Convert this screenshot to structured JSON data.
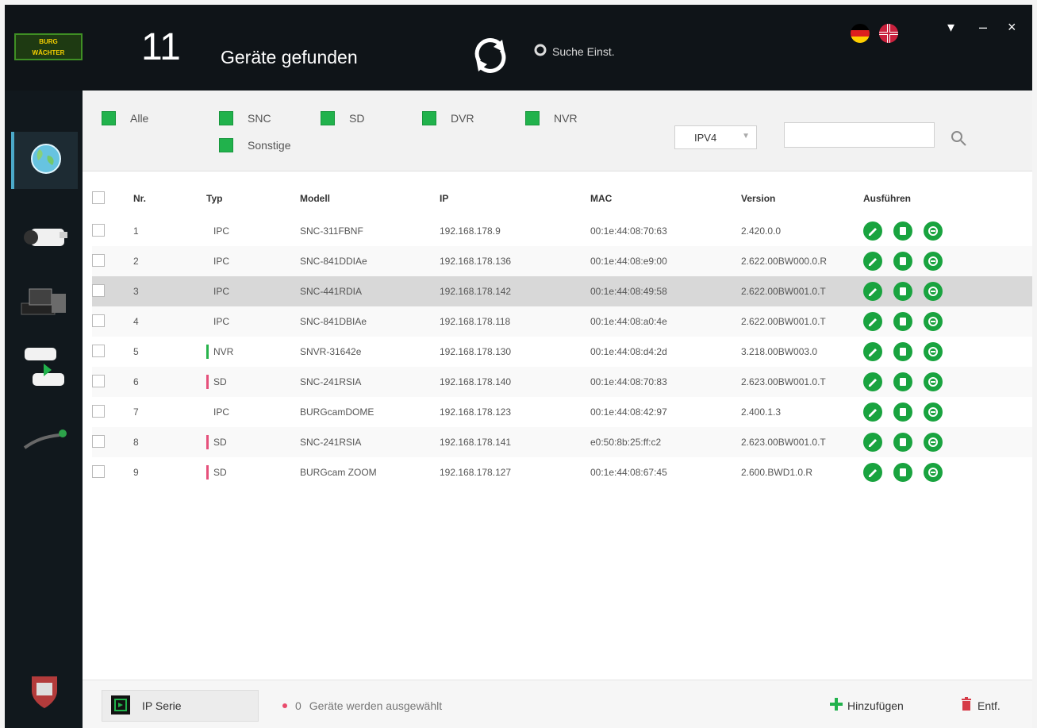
{
  "header": {
    "logo_text": [
      "BURG",
      "WÄCHTER"
    ],
    "count": "11",
    "found_label": "Geräte gefunden",
    "search_settings": "Suche Einst.",
    "window_controls": [
      "▾",
      "–",
      "×"
    ]
  },
  "filters": {
    "items": [
      "Alle",
      "SNC",
      "SD",
      "DVR",
      "NVR",
      "Sonstige"
    ],
    "select_value": "IPV4",
    "search_value": ""
  },
  "table": {
    "columns": [
      "Nr.",
      "Typ",
      "Modell",
      "IP",
      "MAC",
      "Version",
      "Ausführen"
    ],
    "rows": [
      {
        "nr": "1",
        "typ": "IPC",
        "model": "SNC-311FBNF",
        "ip": "192.168.178.9",
        "mac": "00:1e:44:08:70:63",
        "version": "2.420.0.0"
      },
      {
        "nr": "2",
        "typ": "IPC",
        "model": "SNC-841DDIAe",
        "ip": "192.168.178.136",
        "mac": "00:1e:44:08:e9:00",
        "version": "2.622.00BW000.0.R"
      },
      {
        "nr": "3",
        "typ": "IPC",
        "model": "SNC-441RDIA",
        "ip": "192.168.178.142",
        "mac": "00:1e:44:08:49:58",
        "version": "2.622.00BW001.0.T"
      },
      {
        "nr": "4",
        "typ": "IPC",
        "model": "SNC-841DBIAe",
        "ip": "192.168.178.118",
        "mac": "00:1e:44:08:a0:4e",
        "version": "2.622.00BW001.0.T"
      },
      {
        "nr": "5",
        "typ": "NVR",
        "model": "SNVR-31642e",
        "ip": "192.168.178.130",
        "mac": "00:1e:44:08:d4:2d",
        "version": "3.218.00BW003.0"
      },
      {
        "nr": "6",
        "typ": "SD",
        "model": "SNC-241RSIA",
        "ip": "192.168.178.140",
        "mac": "00:1e:44:08:70:83",
        "version": "2.623.00BW001.0.T"
      },
      {
        "nr": "7",
        "typ": "IPC",
        "model": "BURGcamDOME",
        "ip": "192.168.178.123",
        "mac": "00:1e:44:08:42:97",
        "version": "2.400.1.3"
      },
      {
        "nr": "8",
        "typ": "SD",
        "model": "SNC-241RSIA",
        "ip": "192.168.178.141",
        "mac": "e0:50:8b:25:ff:c2",
        "version": "2.623.00BW001.0.T"
      },
      {
        "nr": "9",
        "typ": "SD",
        "model": "BURGcam ZOOM",
        "ip": "192.168.178.127",
        "mac": "00:1e:44:08:67:45",
        "version": "2.600.BWD1.0.R"
      }
    ],
    "selected_row": "3"
  },
  "footer": {
    "ip_serial_label": "IP Serie",
    "selected_count": "0",
    "selected_text": "Geräte werden ausgewählt",
    "add_label": "Hinzufügen",
    "delete_label": "Entf."
  },
  "colors": {
    "accent": "#21b24c",
    "titlebar": "#0f1418",
    "sidebar": "#11181d",
    "type_nvr": "#28b34c",
    "type_sd": "#e6507b"
  },
  "icons": {
    "refresh": "refresh-icon",
    "gear": "gear-icon",
    "globe": "globe-icon",
    "camera": "camera-icon",
    "dvr": "dvr-icon",
    "network_camera": "network-camera-icon",
    "tool": "tool-icon",
    "support": "support-icon",
    "search": "search-icon",
    "plus": "plus-icon",
    "trash": "trash-icon",
    "edit": "edit-icon",
    "copy": "copy-icon",
    "more": "more-icon"
  }
}
